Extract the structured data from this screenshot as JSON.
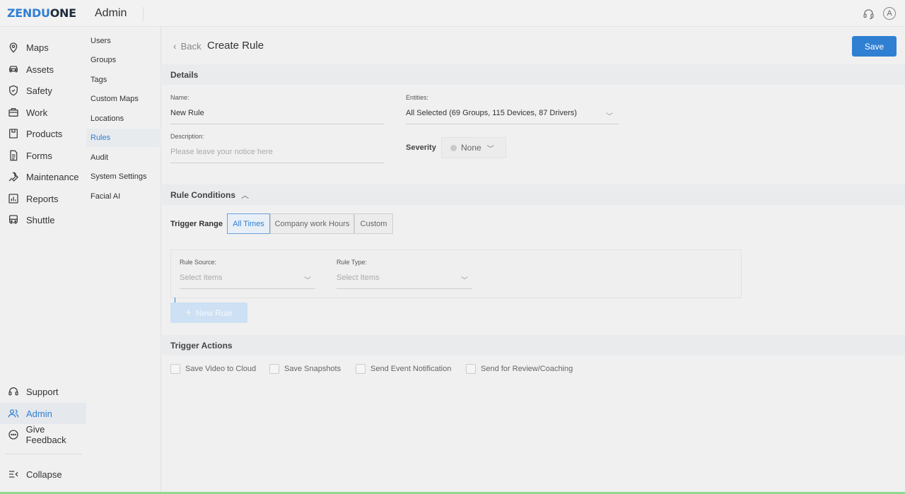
{
  "brand": {
    "logo_z": "ZENDU",
    "logo_rest": "ONE"
  },
  "header": {
    "title": "Admin"
  },
  "sidebar": {
    "items": [
      {
        "label": "Maps",
        "icon": "map-pin-icon"
      },
      {
        "label": "Assets",
        "icon": "car-icon"
      },
      {
        "label": "Safety",
        "icon": "shield-icon"
      },
      {
        "label": "Work",
        "icon": "briefcase-icon"
      },
      {
        "label": "Products",
        "icon": "box-icon"
      },
      {
        "label": "Forms",
        "icon": "document-icon"
      },
      {
        "label": "Maintenance",
        "icon": "wrench-icon"
      },
      {
        "label": "Reports",
        "icon": "bar-chart-icon"
      },
      {
        "label": "Shuttle",
        "icon": "bus-icon"
      }
    ],
    "bottom": [
      {
        "label": "Support",
        "icon": "headset-icon"
      },
      {
        "label": "Admin",
        "icon": "users-icon",
        "active": true
      },
      {
        "label": "Give Feedback",
        "icon": "chat-icon"
      }
    ],
    "collapse_label": "Collapse"
  },
  "subnav": {
    "items": [
      "Users",
      "Groups",
      "Tags",
      "Custom Maps",
      "Locations",
      "Rules",
      "Audit",
      "System Settings",
      "Facial AI"
    ],
    "active": "Rules"
  },
  "page": {
    "back_label": "Back",
    "title": "Create Rule",
    "save_label": "Save"
  },
  "details": {
    "heading": "Details",
    "name_label": "Name:",
    "name_value": "New Rule",
    "entities_label": "Entities:",
    "entities_value": "All Selected (69 Groups, 115 Devices, 87 Drivers)",
    "description_label": "Description:",
    "description_placeholder": "Please leave your notice here",
    "severity_label": "Severity",
    "severity_value": "None"
  },
  "conditions": {
    "heading": "Rule Conditions",
    "trigger_range_label": "Trigger Range",
    "ranges": [
      "All Times",
      "Company work Hours",
      "Custom"
    ],
    "active_range": "All Times",
    "rule_source_label": "Rule Source:",
    "rule_source_placeholder": "Select Items",
    "rule_type_label": "Rule Type:",
    "rule_type_placeholder": "Select Items",
    "new_rule_label": "New Rule"
  },
  "actions": {
    "heading": "Trigger Actions",
    "items": [
      "Save Video to Cloud",
      "Save Snapshots",
      "Send Event Notification",
      "Send for Review/Coaching"
    ]
  },
  "colors": {
    "accent": "#2f7fd2",
    "save_bg": "#2f7fd2",
    "disabled_btn": "#cde0f4"
  }
}
